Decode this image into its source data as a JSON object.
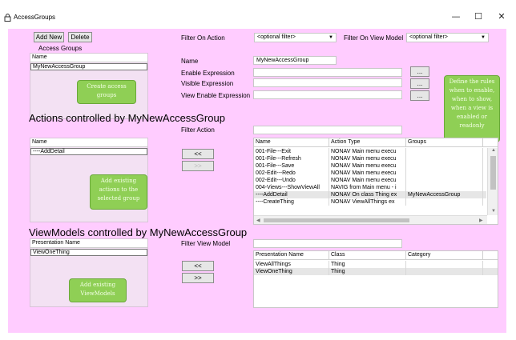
{
  "window": {
    "title": "AccessGroups",
    "minimize": "—",
    "maximize": "☐",
    "close": "✕"
  },
  "access_groups": {
    "add_new": "Add New",
    "delete": "Delete",
    "label": "Access Groups",
    "header": "Name",
    "items": [
      "MyNewAccessGroup"
    ],
    "note": [
      "Create access",
      "groups"
    ]
  },
  "filters": {
    "action_label": "Filter On Action",
    "action_value": "<optional filter>",
    "viewmodel_label": "Filter On View Model",
    "viewmodel_value": "<optional filter>"
  },
  "details": {
    "name_label": "Name",
    "name_value": "MyNewAccessGroup",
    "enable_label": "Enable Expression",
    "visible_label": "Visible Expression",
    "view_enable_label": "View Enable Expression",
    "browse_label": "...",
    "note": [
      "Define the rules",
      "when to enable,",
      "when to show,",
      "when a view is",
      "enabled or",
      "readonly"
    ]
  },
  "actions": {
    "heading": "Actions controlled by MyNewAccessGroup",
    "left_header": "Name",
    "left_items": [
      "----AddDetail"
    ],
    "note": [
      "Add existing",
      "actions to the",
      "selected group"
    ],
    "filter_label": "Filter Action",
    "add_btn": "<<",
    "remove_btn": ">>",
    "columns": [
      "Name",
      "Action Type",
      "Groups"
    ],
    "rows": [
      [
        "001-File---Exit",
        "NONAV Main menu execu",
        ""
      ],
      [
        "001-File---Refresh",
        "NONAV Main menu execu",
        ""
      ],
      [
        "001-File---Save",
        "NONAV Main menu execu",
        ""
      ],
      [
        "002-Edit---Redo",
        "NONAV Main menu execu",
        ""
      ],
      [
        "002-Edit---Undo",
        "NONAV Main menu execu",
        ""
      ],
      [
        "004-Views---ShowViewAll",
        "NAVIG from Main menu - i",
        ""
      ],
      [
        "----AddDetail",
        "NONAV On class Thing ex",
        "MyNewAccessGroup"
      ],
      [
        "----CreateThing",
        "NONAV ViewAllThings ex",
        ""
      ]
    ]
  },
  "viewmodels": {
    "heading": "ViewModels controlled by MyNewAccessGroup",
    "left_header": "Presentation Name",
    "left_items": [
      "ViewOneThing"
    ],
    "note": [
      "Add existing",
      "ViewModels"
    ],
    "filter_label": "Filter View Model",
    "add_btn": "<<",
    "remove_btn": ">>",
    "columns": [
      "Presentation Name",
      "Class",
      "Category"
    ],
    "rows": [
      [
        "ViewAllThings",
        "Thing",
        ""
      ],
      [
        "ViewOneThing",
        "Thing",
        ""
      ]
    ]
  },
  "colors": {
    "background": "#ffccff",
    "note_green": "#8fcf55"
  }
}
